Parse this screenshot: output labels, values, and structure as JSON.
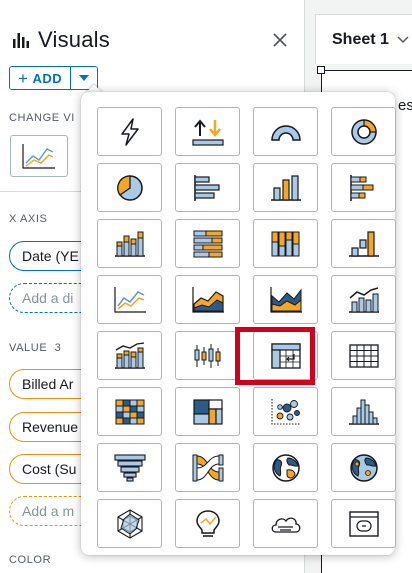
{
  "panel": {
    "title": "Visuals",
    "add_button_label": "ADD",
    "change_visual_label": "CHANGE VI",
    "x_axis_label": "X AXIS",
    "value_label": "VALUE",
    "value_count": "3",
    "color_label": "COLOR"
  },
  "x_axis_fields": [
    {
      "text": "Date (YE"
    }
  ],
  "x_axis_placeholder": "Add a di",
  "value_fields": [
    {
      "text": "Billed Ar"
    },
    {
      "text": "Revenue"
    },
    {
      "text": "Cost (Su"
    }
  ],
  "value_placeholder": "Add a m",
  "sheet": {
    "tab_title": "Sheet 1",
    "canvas_text": "es"
  },
  "colors": {
    "accent": "#0073bb",
    "field_orange": "#e8920f",
    "highlight_red": "#d0021b",
    "icon_blue": "#a9c9e4",
    "icon_orange": "#f5a623",
    "icon_dark": "#16191f"
  },
  "visual_types": [
    "autograph-icon",
    "kpi-icon",
    "gauge-icon",
    "donut-chart-icon",
    "pie-chart-icon",
    "horizontal-bar-icon",
    "vertical-bar-icon",
    "horizontal-stacked-bar-icon",
    "vertical-stacked-bar-icon",
    "horizontal-100-stacked-icon",
    "vertical-100-stacked-icon",
    "waterfall-icon",
    "line-chart-icon",
    "area-chart-icon",
    "stacked-area-icon",
    "bar-line-combo-icon",
    "clustered-bar-combo-icon",
    "box-plot-icon",
    "pivot-table-icon",
    "table-icon",
    "heat-map-icon",
    "tree-map-icon",
    "scatter-plot-icon",
    "histogram-icon",
    "funnel-icon",
    "sankey-icon",
    "filled-map-icon",
    "points-map-icon",
    "radar-chart-icon",
    "insight-icon",
    "word-cloud-icon",
    "custom-visual-icon"
  ],
  "selected_visual": "pivot-table-icon"
}
